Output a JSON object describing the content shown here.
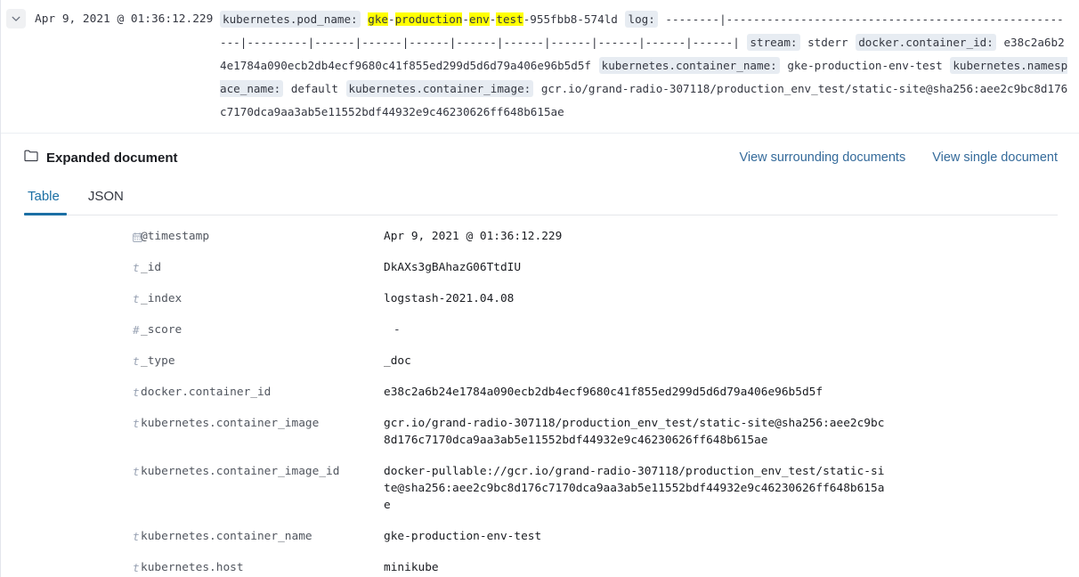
{
  "doc_row": {
    "expand_icon": "chevron-down-icon",
    "timestamp": "Apr 9, 2021 @ 01:36:12.229",
    "summary_fields": [
      {
        "key": "kubernetes.pod_name:",
        "value": "gke-production-env-test-955fbb8-574ld",
        "highlight_tokens": [
          "gke",
          "production",
          "env",
          "test"
        ]
      },
      {
        "key": "log:",
        "value": "--------|-----------------------------------------------------|---------|------|------|------|------|------|------|------|------|------|"
      },
      {
        "key": "stream:",
        "value": "stderr"
      },
      {
        "key": "docker.container_id:",
        "value": "e38c2a6b24e1784a090ecb2db4ecf9680c41f855ed299d5d6d79a406e96b5d5f"
      },
      {
        "key": "kubernetes.container_name:",
        "value": "gke-production-env-test"
      },
      {
        "key": "kubernetes.namespace_name:",
        "value": "default"
      },
      {
        "key": "kubernetes.container_image:",
        "value": "gcr.io/grand-radio-307118/production_env_test/static-site@sha256:aee2c9bc8d176c7170dca9aa3ab5e11552bdf44932e9c46230626ff648b615ae"
      }
    ]
  },
  "expanded": {
    "folder_icon": "folder-icon",
    "title": "Expanded document",
    "links": [
      {
        "label": "View surrounding documents",
        "name": "view-surrounding-documents-link"
      },
      {
        "label": "View single document",
        "name": "view-single-document-link"
      }
    ]
  },
  "tabs": [
    {
      "label": "Table",
      "active": true,
      "name": "tab-table"
    },
    {
      "label": "JSON",
      "active": false,
      "name": "tab-json"
    }
  ],
  "fields": [
    {
      "icon": "calendar-icon",
      "type": "date",
      "name": "@timestamp",
      "value": "Apr 9, 2021 @ 01:36:12.229"
    },
    {
      "icon": "string-type-icon",
      "type": "string",
      "name": "_id",
      "value": "DkAXs3gBAhazG06TtdIU"
    },
    {
      "icon": "string-type-icon",
      "type": "string",
      "name": "_index",
      "value": "logstash-2021.04.08"
    },
    {
      "icon": "number-type-icon",
      "type": "number",
      "name": "_score",
      "value": "-"
    },
    {
      "icon": "string-type-icon",
      "type": "string",
      "name": "_type",
      "value": "_doc"
    },
    {
      "icon": "string-type-icon",
      "type": "string",
      "name": "docker.container_id",
      "value": "e38c2a6b24e1784a090ecb2db4ecf9680c41f855ed299d5d6d79a406e96b5d5f"
    },
    {
      "icon": "string-type-icon",
      "type": "string",
      "name": "kubernetes.container_image",
      "value": "gcr.io/grand-radio-307118/production_env_test/static-site@sha256:aee2c9bc8d176c7170dca9aa3ab5e11552bdf44932e9c46230626ff648b615ae"
    },
    {
      "icon": "string-type-icon",
      "type": "string",
      "name": "kubernetes.container_image_id",
      "value": "docker-pullable://gcr.io/grand-radio-307118/production_env_test/static-site@sha256:aee2c9bc8d176c7170dca9aa3ab5e11552bdf44932e9c46230626ff648b615ae"
    },
    {
      "icon": "string-type-icon",
      "type": "string",
      "name": "kubernetes.container_name",
      "value": "gke-production-env-test"
    },
    {
      "icon": "string-type-icon",
      "type": "string",
      "name": "kubernetes.host",
      "value": "minikube"
    }
  ],
  "colors": {
    "link": "#356b9b",
    "tab_active": "#1b6fa4",
    "highlight": "#ffff00",
    "field_key_badge": "#e7ecf2"
  }
}
